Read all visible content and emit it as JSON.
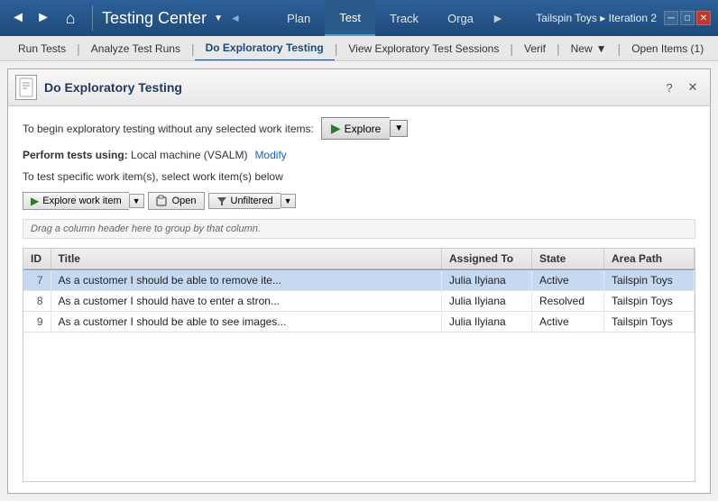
{
  "titleBar": {
    "backBtn": "◄",
    "forwardBtn": "►",
    "homeBtn": "⌂",
    "appTitle": "Testing Center",
    "dropdownArrow": "▼",
    "navTabs": [
      {
        "label": "Plan",
        "active": false
      },
      {
        "label": "Test",
        "active": true
      },
      {
        "label": "Track",
        "active": false
      },
      {
        "label": "Orga",
        "active": false
      }
    ],
    "rightInfo": "Tailspin Toys ▸ Iteration 2",
    "winMinimize": "─",
    "winMaximize": "□",
    "winClose": "✕"
  },
  "secondaryNav": {
    "tabs": [
      {
        "label": "Run Tests",
        "active": false
      },
      {
        "label": "Analyze Test Runs",
        "active": false
      },
      {
        "label": "Do Exploratory Testing",
        "active": true
      },
      {
        "label": "View Exploratory Test Sessions",
        "active": false
      },
      {
        "label": "Verif",
        "active": false
      }
    ],
    "newBtn": "New",
    "openItemsBtn": "Open Items (1)"
  },
  "dialog": {
    "title": "Do Exploratory Testing",
    "helpBtn": "?",
    "closeBtn": "✕",
    "line1": "To begin exploratory testing without any selected work items:",
    "exploreBtn": "Explore",
    "performLine": {
      "prefix": "Perform tests using:",
      "machine": "Local machine (VSALM)",
      "modifyLink": "Modify"
    },
    "testLine": "To test specific work item(s), select work item(s) below",
    "toolbar": {
      "exploreWorkItem": "Explore work item",
      "openBtn": "Open",
      "filterBtn": "Unfiltered"
    },
    "dragHint": "Drag a column header here to group by that column.",
    "table": {
      "columns": [
        "ID",
        "Title",
        "Assigned To",
        "State",
        "Area Path"
      ],
      "rows": [
        {
          "id": "7",
          "title": "As a customer I should be able to remove ite...",
          "assignedTo": "Julia Ilyiana",
          "state": "Active",
          "areaPath": "Tailspin Toys",
          "selected": true
        },
        {
          "id": "8",
          "title": "As a customer I should have to enter a stron...",
          "assignedTo": "Julia Ilyiana",
          "state": "Resolved",
          "areaPath": "Tailspin Toys",
          "selected": false
        },
        {
          "id": "9",
          "title": "As a customer I should be able to see images...",
          "assignedTo": "Julia Ilyiana",
          "state": "Active",
          "areaPath": "Tailspin Toys",
          "selected": false
        }
      ]
    }
  }
}
